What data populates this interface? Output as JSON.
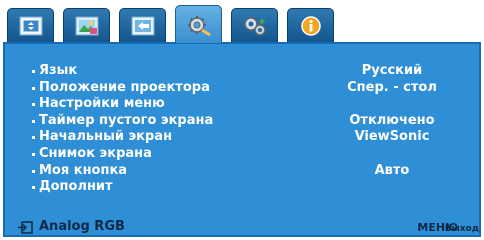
{
  "tabs": [
    {
      "name": "display-icon",
      "active": false
    },
    {
      "name": "picture-icon",
      "active": false
    },
    {
      "name": "source-icon",
      "active": false
    },
    {
      "name": "system-setup-gear-icon",
      "active": true
    },
    {
      "name": "advanced-setup-gears-icon",
      "active": false
    },
    {
      "name": "information-icon",
      "active": false
    }
  ],
  "menu": {
    "items": [
      {
        "label": "Язык",
        "value": "Русский"
      },
      {
        "label": "Положение проектора",
        "value": "Спер. - стол"
      },
      {
        "label": "Настройки меню",
        "value": ""
      },
      {
        "label": "Таймер пустого экрана",
        "value": "Отключено"
      },
      {
        "label": "Начальный экран",
        "value": "ViewSonic"
      },
      {
        "label": "Снимок экрана",
        "value": ""
      },
      {
        "label": "Моя кнопка",
        "value": "Авто"
      },
      {
        "label": "Дополнит",
        "value": ""
      }
    ]
  },
  "status": {
    "source_icon": "input-source-icon",
    "source": "Analog RGB",
    "menu_key": "МЕНЮ",
    "exit": "Выход"
  },
  "colors": {
    "panel": "#2f8fd6",
    "tab": "#1a6ab0",
    "tab_active": "#4ea0de",
    "status_text": "#0e2a48"
  }
}
